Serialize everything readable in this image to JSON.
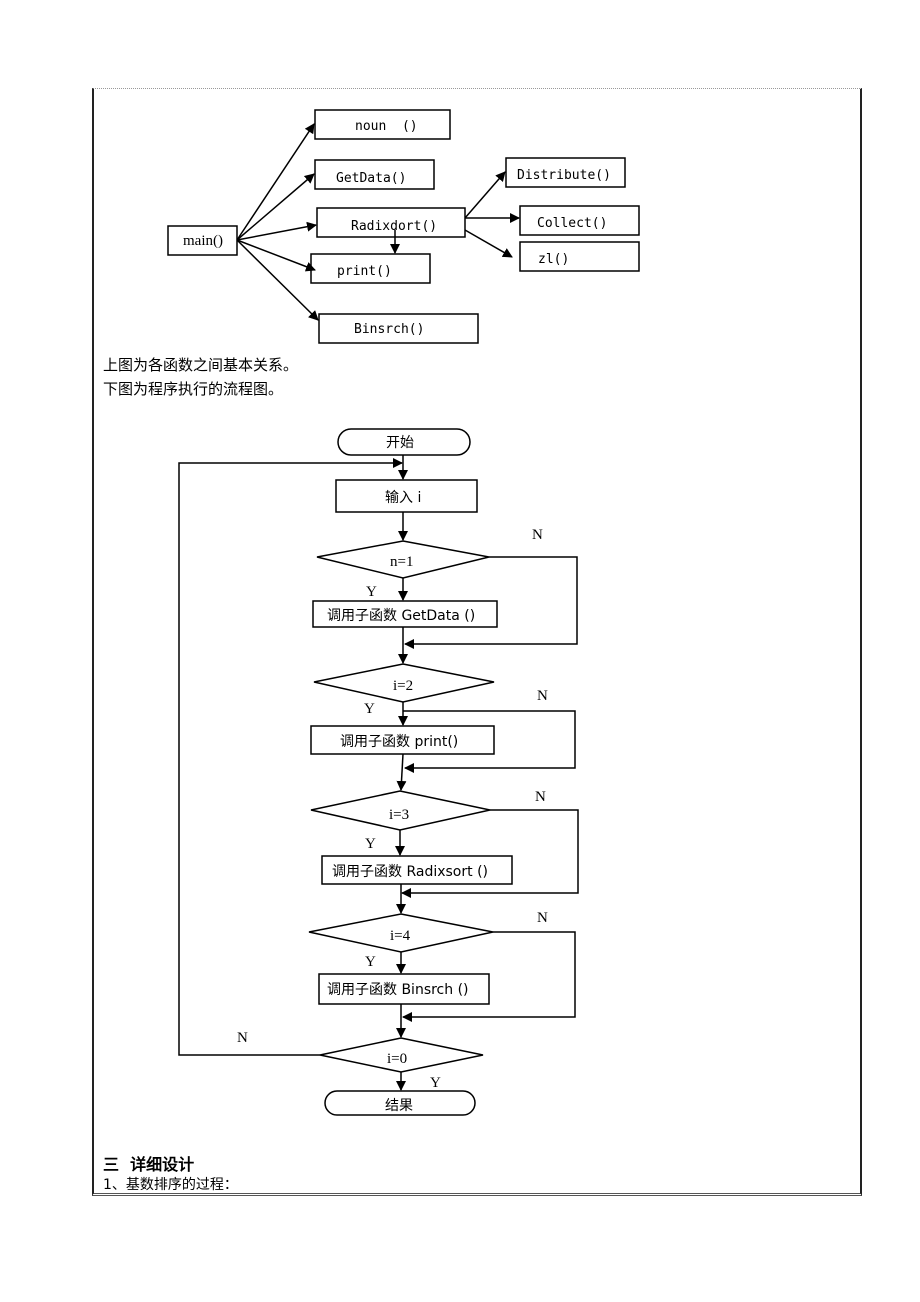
{
  "call_graph": {
    "root": "main()",
    "children": [
      "noun  ()",
      "GetData()",
      "Radixdort()",
      "print()",
      "Binsrch()"
    ],
    "radix_children": [
      "Distribute()",
      "Collect()",
      "zl()"
    ]
  },
  "captions": {
    "line1": "上图为各函数之间基本关系。",
    "line2": "下图为程序执行的流程图。"
  },
  "flowchart": {
    "start": "开始",
    "input": "输入 i",
    "decisions": [
      "n=1",
      "i=2",
      "i=3",
      "i=4",
      "i=0"
    ],
    "actions": [
      "调用子函数 GetData ()",
      "调用子函数 print()",
      "调用子函数 Radixsort ()",
      "调用子函数 Binsrch ()"
    ],
    "yes": "Y",
    "no": "N",
    "end": "结果"
  },
  "section": {
    "heading": "三  详细设计",
    "item1": "1、基数排序的过程："
  }
}
